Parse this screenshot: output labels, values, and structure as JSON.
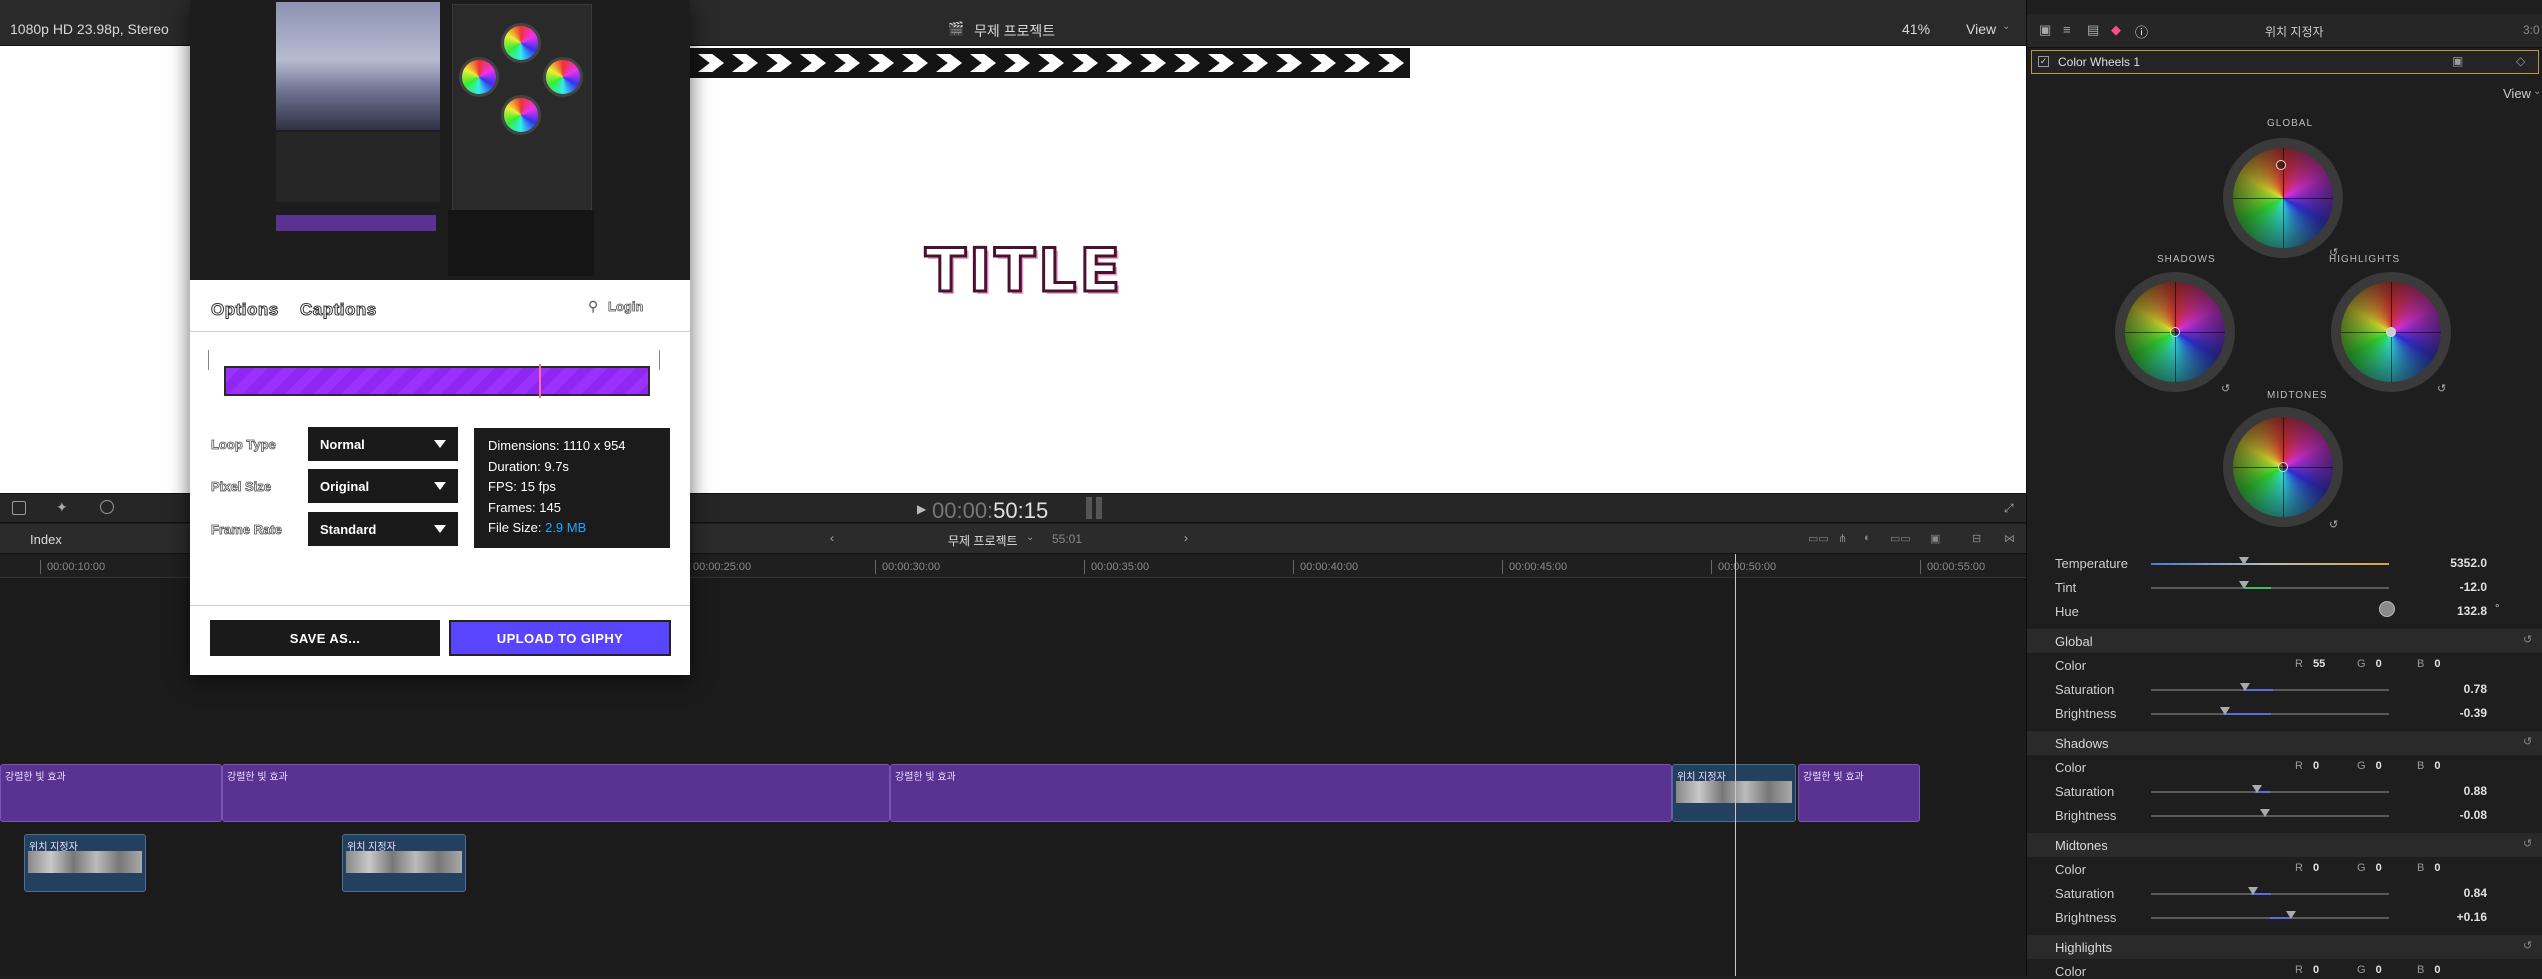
{
  "viewer": {
    "format": "1080p HD 23.98p, Stereo",
    "project_title": "무제 프로젝트",
    "zoom": "41%",
    "view_label": "View",
    "title_text": "TITLE",
    "timecode_dim": "00:00:",
    "timecode_main": "50:15"
  },
  "timeline": {
    "index_label": "Index",
    "project_name": "무제 프로젝트",
    "duration": "55:01",
    "ruler": [
      "00:00:10:00",
      "00:00:25:00",
      "00:00:30:00",
      "00:00:35:00",
      "00:00:40:00",
      "00:00:45:00",
      "00:00:50:00",
      "00:00:55:00"
    ],
    "clips_top": [
      "강렬한 빛 효과",
      "강렬한 빛 효과",
      "강렬한 빛 효과",
      "위치 지정자",
      "강렬한 빛 효과"
    ],
    "clips_bottom": [
      "위치 지정자",
      "위치 지정자"
    ]
  },
  "giphy": {
    "tabs": {
      "options": "Options",
      "captions": "Captions"
    },
    "login": "Login",
    "loop_type_label": "Loop Type",
    "loop_type_value": "Normal",
    "pixel_size_label": "Pixel Size",
    "pixel_size_value": "Original",
    "frame_rate_label": "Frame Rate",
    "frame_rate_value": "Standard",
    "dimensions": "Dimensions: 1110 x 954",
    "duration": "Duration: 9.7s",
    "fps": "FPS: 15 fps",
    "frames": "Frames: 145",
    "file_size_label": "File Size:",
    "file_size_value": "2.9 MB",
    "save_as": "SAVE AS...",
    "upload": "UPLOAD TO GIPHY",
    "colors": {
      "upload_bg": "#5a45ff",
      "bar": "#9b30ff",
      "file_size": "#1ea7ff"
    }
  },
  "inspector": {
    "header_title": "위치 지정자",
    "header_time": "3:0",
    "effect_name": "Color Wheels 1",
    "view_label": "View",
    "wheels": {
      "global": "GLOBAL",
      "shadows": "SHADOWS",
      "highlights": "HIGHLIGHTS",
      "midtones": "MIDTONES"
    },
    "temperature_label": "Temperature",
    "temperature_value": "5352.0",
    "tint_label": "Tint",
    "tint_value": "-12.0",
    "hue_label": "Hue",
    "hue_value": "132.8",
    "hue_unit": "°",
    "sections": {
      "global": {
        "title": "Global",
        "color_label": "Color",
        "r": "55",
        "g": "0",
        "b": "0",
        "sat_label": "Saturation",
        "sat": "0.78",
        "bri_label": "Brightness",
        "bri": "-0.39"
      },
      "shadows": {
        "title": "Shadows",
        "color_label": "Color",
        "r": "0",
        "g": "0",
        "b": "0",
        "sat_label": "Saturation",
        "sat": "0.88",
        "bri_label": "Brightness",
        "bri": "-0.08"
      },
      "midtones": {
        "title": "Midtones",
        "color_label": "Color",
        "r": "0",
        "g": "0",
        "b": "0",
        "sat_label": "Saturation",
        "sat": "0.84",
        "bri_label": "Brightness",
        "bri": "+0.16"
      },
      "highlights": {
        "title": "Highlights",
        "color_label": "Color",
        "r": "0",
        "g": "0",
        "b": "0"
      }
    }
  }
}
